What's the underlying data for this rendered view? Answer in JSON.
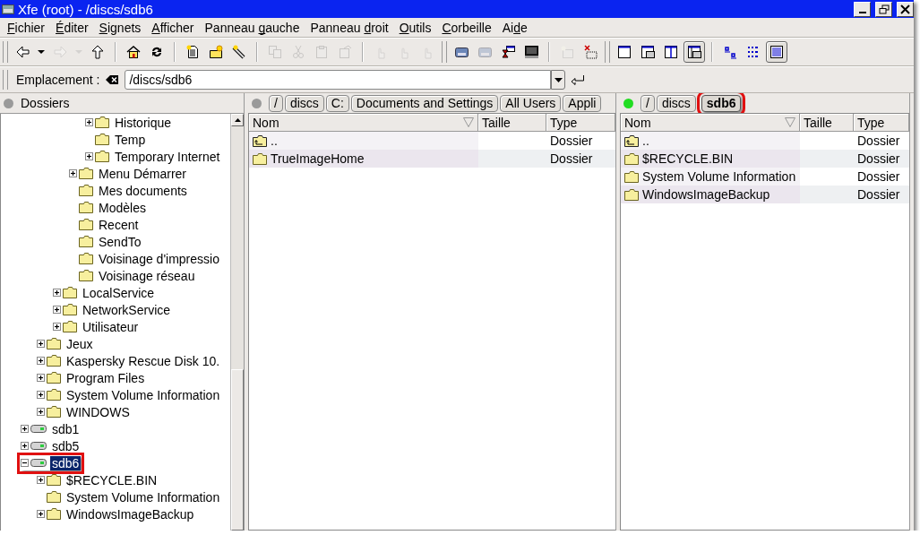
{
  "window": {
    "title": "Xfe (root) - /discs/sdb6"
  },
  "menu": [
    {
      "parts": [
        {
          "text": "F",
          "underline": true
        },
        {
          "text": "ichier",
          "underline": false
        }
      ]
    },
    {
      "parts": [
        {
          "text": "É",
          "underline": true
        },
        {
          "text": "diter",
          "underline": false
        }
      ]
    },
    {
      "parts": [
        {
          "text": "S",
          "underline": true
        },
        {
          "text": "ignets",
          "underline": false
        }
      ]
    },
    {
      "parts": [
        {
          "text": "A",
          "underline": true
        },
        {
          "text": "fficher",
          "underline": false
        }
      ]
    },
    {
      "parts": [
        {
          "text": "Panneau ",
          "underline": false
        },
        {
          "text": "g",
          "underline": true
        },
        {
          "text": "auche",
          "underline": false
        }
      ]
    },
    {
      "parts": [
        {
          "text": "Panneau ",
          "underline": false
        },
        {
          "text": "d",
          "underline": true
        },
        {
          "text": "roit",
          "underline": false
        }
      ]
    },
    {
      "parts": [
        {
          "text": "O",
          "underline": true
        },
        {
          "text": "utils",
          "underline": false
        }
      ]
    },
    {
      "parts": [
        {
          "text": "C",
          "underline": true
        },
        {
          "text": "orbeille",
          "underline": false
        }
      ]
    },
    {
      "parts": [
        {
          "text": "Ai",
          "underline": false
        },
        {
          "text": "d",
          "underline": true
        },
        {
          "text": "e",
          "underline": false
        }
      ]
    }
  ],
  "toolbar": [
    [
      {
        "kind": "back",
        "disabled": false,
        "pressed": false
      },
      {
        "kind": "caret",
        "disabled": false,
        "pressed": false
      },
      {
        "kind": "forward",
        "disabled": true,
        "pressed": false
      },
      {
        "kind": "caret",
        "disabled": true,
        "pressed": false
      },
      {
        "kind": "up",
        "disabled": false,
        "pressed": false
      }
    ],
    [
      {
        "kind": "home",
        "disabled": false,
        "pressed": false
      },
      {
        "kind": "refresh",
        "disabled": false,
        "pressed": false
      }
    ],
    [
      {
        "kind": "newfile",
        "disabled": false,
        "pressed": false
      },
      {
        "kind": "newfolder",
        "disabled": false,
        "pressed": false
      },
      {
        "kind": "link",
        "disabled": false,
        "pressed": false
      }
    ],
    [
      {
        "kind": "copy",
        "disabled": true,
        "pressed": false
      },
      {
        "kind": "cut",
        "disabled": true,
        "pressed": false
      },
      {
        "kind": "paste",
        "disabled": true,
        "pressed": false
      },
      {
        "kind": "props",
        "disabled": true,
        "pressed": false
      }
    ],
    [
      {
        "kind": "hand",
        "disabled": true,
        "pressed": false
      },
      {
        "kind": "hand",
        "disabled": true,
        "pressed": false
      },
      {
        "kind": "hand",
        "disabled": true,
        "pressed": false
      }
    ],
    [
      {
        "kind": "drive",
        "disabled": false,
        "pressed": false
      },
      {
        "kind": "drive",
        "disabled": true,
        "pressed": false
      },
      {
        "kind": "hourglass",
        "disabled": false,
        "pressed": false
      },
      {
        "kind": "monitor",
        "disabled": false,
        "pressed": false
      }
    ],
    [
      {
        "kind": "newwin",
        "disabled": true,
        "pressed": false
      },
      {
        "kind": "delete",
        "disabled": false,
        "pressed": false
      }
    ],
    [
      {
        "kind": "onepanel",
        "disabled": false,
        "pressed": false
      },
      {
        "kind": "treepanel",
        "disabled": false,
        "pressed": false
      },
      {
        "kind": "twopanels",
        "disabled": false,
        "pressed": false
      },
      {
        "kind": "treetwopanels",
        "disabled": false,
        "pressed": true
      }
    ],
    [
      {
        "kind": "bigicons",
        "disabled": false,
        "pressed": false
      },
      {
        "kind": "smallicons",
        "disabled": false,
        "pressed": false
      },
      {
        "kind": "details",
        "disabled": false,
        "pressed": true
      }
    ]
  ],
  "location": {
    "label": "Emplacement :",
    "value": "/discs/sdb6"
  },
  "tree": {
    "title": "Dossiers",
    "items": [
      {
        "children": [
          {
            "children": [
              {
                "children": [
                  {
                    "children": [
                      {
                        "label": "Historique",
                        "kind": "folder",
                        "expandable": true,
                        "expanded": false,
                        "selected": false,
                        "highlighted": false
                      },
                      {
                        "label": "Temp",
                        "kind": "folder",
                        "expandable": false,
                        "selected": false,
                        "highlighted": false
                      },
                      {
                        "label": "Temporary Internet",
                        "kind": "folder",
                        "expandable": true,
                        "expanded": false,
                        "selected": false,
                        "highlighted": false
                      }
                    ]
                  },
                  {
                    "label": "Menu Démarrer",
                    "kind": "folder",
                    "expandable": true,
                    "expanded": false,
                    "selected": false,
                    "highlighted": false
                  },
                  {
                    "label": "Mes documents",
                    "kind": "folder",
                    "expandable": false,
                    "selected": false,
                    "highlighted": false
                  },
                  {
                    "label": "Modèles",
                    "kind": "folder",
                    "expandable": false,
                    "selected": false,
                    "highlighted": false
                  },
                  {
                    "label": "Recent",
                    "kind": "folder",
                    "expandable": false,
                    "selected": false,
                    "highlighted": false
                  },
                  {
                    "label": "SendTo",
                    "kind": "folder",
                    "expandable": false,
                    "selected": false,
                    "highlighted": false
                  },
                  {
                    "label": "Voisinage d'impressio",
                    "kind": "folder",
                    "expandable": false,
                    "selected": false,
                    "highlighted": false
                  },
                  {
                    "label": "Voisinage réseau",
                    "kind": "folder",
                    "expandable": false,
                    "selected": false,
                    "highlighted": false
                  }
                ]
              },
              {
                "label": "LocalService",
                "kind": "folder",
                "expandable": true,
                "expanded": false,
                "selected": false,
                "highlighted": false
              },
              {
                "label": "NetworkService",
                "kind": "folder",
                "expandable": true,
                "expanded": false,
                "selected": false,
                "highlighted": false
              },
              {
                "label": "Utilisateur",
                "kind": "folder",
                "expandable": true,
                "expanded": false,
                "selected": false,
                "highlighted": false
              }
            ]
          },
          {
            "label": "Jeux",
            "kind": "folder",
            "expandable": true,
            "expanded": false,
            "selected": false,
            "highlighted": false
          },
          {
            "label": "Kaspersky Rescue Disk 10.",
            "kind": "folder",
            "expandable": true,
            "expanded": false,
            "selected": false,
            "highlighted": false
          },
          {
            "label": "Program Files",
            "kind": "folder",
            "expandable": true,
            "expanded": false,
            "selected": false,
            "highlighted": false
          },
          {
            "label": "System Volume Information",
            "kind": "folder",
            "expandable": true,
            "expanded": false,
            "selected": false,
            "highlighted": false
          },
          {
            "label": "WINDOWS",
            "kind": "folder",
            "expandable": true,
            "expanded": false,
            "selected": false,
            "highlighted": false
          }
        ]
      },
      {
        "label": "sdb1",
        "kind": "drive",
        "expandable": true,
        "expanded": false,
        "selected": false,
        "highlighted": false
      },
      {
        "label": "sdb5",
        "kind": "drive",
        "expandable": true,
        "expanded": false,
        "selected": false,
        "highlighted": false
      },
      {
        "label": "sdb6",
        "kind": "drive",
        "expandable": true,
        "expanded": true,
        "selected": true,
        "highlighted": true,
        "children": [
          {
            "label": "$RECYCLE.BIN",
            "kind": "folder",
            "expandable": true,
            "expanded": false,
            "selected": false,
            "highlighted": false
          },
          {
            "label": "System Volume Information",
            "kind": "folder",
            "expandable": false,
            "selected": false,
            "highlighted": false
          },
          {
            "label": "WindowsImageBackup",
            "kind": "folder",
            "expandable": true,
            "expanded": false,
            "selected": false,
            "highlighted": false
          }
        ]
      }
    ]
  },
  "panels": [
    {
      "active": false,
      "path": [
        {
          "label": "/",
          "selected": false,
          "highlighted": false
        },
        {
          "label": "discs",
          "selected": false,
          "highlighted": false
        },
        {
          "label": "C:",
          "selected": false,
          "highlighted": false
        },
        {
          "label": "Documents and Settings",
          "selected": false,
          "highlighted": false
        },
        {
          "label": "All Users",
          "selected": false,
          "highlighted": false
        },
        {
          "label": "Appli",
          "selected": false,
          "highlighted": false
        }
      ],
      "columns": [
        "Nom",
        "Taille",
        "Type"
      ],
      "rows": [
        {
          "kind": "parent",
          "name": "..",
          "type": "Dossier"
        },
        {
          "kind": "folder",
          "name": "TrueImageHome",
          "type": "Dossier"
        }
      ]
    },
    {
      "active": true,
      "path": [
        {
          "label": "/",
          "selected": false,
          "highlighted": false
        },
        {
          "label": "discs",
          "selected": false,
          "highlighted": false
        },
        {
          "label": "sdb6",
          "selected": true,
          "highlighted": true
        }
      ],
      "columns": [
        "Nom",
        "Taille",
        "Type"
      ],
      "rows": [
        {
          "kind": "parent",
          "name": "..",
          "type": "Dossier"
        },
        {
          "kind": "folder",
          "name": "$RECYCLE.BIN",
          "type": "Dossier"
        },
        {
          "kind": "folder",
          "name": "System Volume Information",
          "type": "Dossier"
        },
        {
          "kind": "folder",
          "name": "WindowsImageBackup",
          "type": "Dossier"
        }
      ]
    }
  ]
}
